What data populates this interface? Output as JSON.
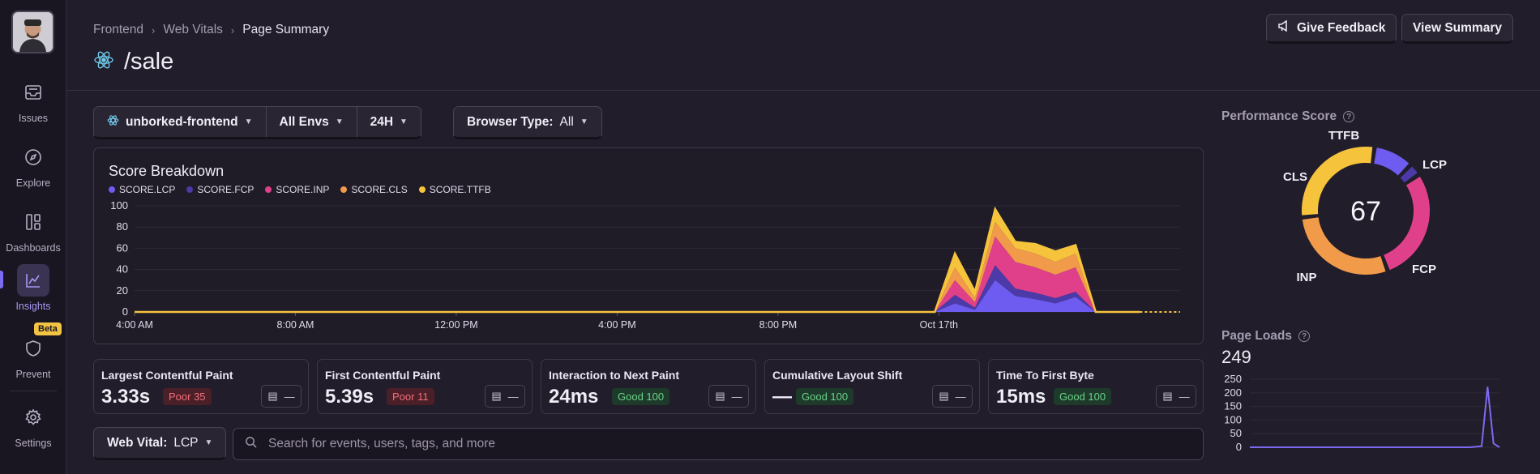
{
  "sidebar": {
    "items": [
      {
        "label": "Issues",
        "icon": "inbox-icon"
      },
      {
        "label": "Explore",
        "icon": "compass-icon"
      },
      {
        "label": "Dashboards",
        "icon": "dashboard-icon"
      },
      {
        "label": "Insights",
        "icon": "chart-icon",
        "active": true
      },
      {
        "label": "Prevent",
        "icon": "shield-icon"
      },
      {
        "label": "Settings",
        "icon": "gear-icon"
      }
    ],
    "beta_badge": "Beta"
  },
  "breadcrumb": [
    "Frontend",
    "Web Vitals",
    "Page Summary"
  ],
  "page": {
    "title": "/sale"
  },
  "header": {
    "feedback_label": "Give Feedback",
    "summary_label": "View Summary"
  },
  "filters": {
    "project": "unborked-frontend",
    "envs": "All Envs",
    "period": "24H",
    "browser_label": "Browser Type:",
    "browser_value": "All"
  },
  "colors": {
    "lcp": "#6e5cf0",
    "fcp": "#4b3aa8",
    "inp": "#e0408a",
    "cls": "#f19a4a",
    "ttfb": "#f6c33d"
  },
  "chart_data": {
    "type": "area",
    "title": "Score Breakdown",
    "legend": [
      "SCORE.LCP",
      "SCORE.FCP",
      "SCORE.INP",
      "SCORE.CLS",
      "SCORE.TTFB"
    ],
    "x_ticks": [
      "4:00 AM",
      "8:00 AM",
      "12:00 PM",
      "4:00 PM",
      "8:00 PM",
      "Oct 17th"
    ],
    "ylim": [
      0,
      100
    ],
    "y_ticks": [
      0,
      20,
      40,
      60,
      80,
      100
    ],
    "x_range_hours": [
      0,
      26
    ],
    "x": [
      0,
      19.9,
      20.4,
      20.9,
      21.4,
      21.9,
      22.4,
      22.9,
      23.4,
      23.9,
      24.4,
      25.0
    ],
    "series": [
      {
        "name": "SCORE.LCP",
        "values": [
          0,
          0,
          8,
          2,
          30,
          15,
          12,
          8,
          14,
          0,
          0,
          0
        ]
      },
      {
        "name": "SCORE.FCP",
        "values": [
          0,
          0,
          8,
          2,
          14,
          7,
          6,
          5,
          5,
          0,
          0,
          0
        ]
      },
      {
        "name": "SCORE.INP",
        "values": [
          0,
          0,
          14,
          5,
          27,
          25,
          24,
          22,
          23,
          0,
          0,
          0
        ]
      },
      {
        "name": "SCORE.CLS",
        "values": [
          0,
          0,
          12,
          4,
          14,
          13,
          13,
          12,
          13,
          0,
          0,
          0
        ]
      },
      {
        "name": "SCORE.TTFB",
        "values": [
          0,
          0,
          13,
          6,
          12,
          6,
          9,
          10,
          8,
          0,
          0,
          0
        ]
      }
    ]
  },
  "metrics": [
    {
      "name": "Largest Contentful Paint",
      "value": "3.33s",
      "badge": "Poor 35",
      "status": "poor"
    },
    {
      "name": "First Contentful Paint",
      "value": "5.39s",
      "badge": "Poor 11",
      "status": "poor"
    },
    {
      "name": "Interaction to Next Paint",
      "value": "24ms",
      "badge": "Good 100",
      "status": "good"
    },
    {
      "name": "Cumulative Layout Shift",
      "value": "—",
      "badge": "Good 100",
      "status": "good"
    },
    {
      "name": "Time To First Byte",
      "value": "15ms",
      "badge": "Good 100",
      "status": "good"
    }
  ],
  "mini_dash": "—",
  "web_vital": {
    "label": "Web Vital:",
    "value": "LCP"
  },
  "search": {
    "placeholder": "Search for events, users, tags, and more"
  },
  "performance": {
    "label": "Performance Score",
    "score": "67",
    "segments": [
      {
        "name": "LCP",
        "value": 35,
        "color": "#6e5cf0"
      },
      {
        "name": "FCP",
        "value": 11,
        "color": "#4b3aa8"
      },
      {
        "name": "INP",
        "value": 100,
        "color": "#e0408a"
      },
      {
        "name": "CLS",
        "value": 100,
        "color": "#f19a4a"
      },
      {
        "name": "TTFB",
        "value": 100,
        "color": "#f6c33d"
      }
    ]
  },
  "page_loads": {
    "label": "Page Loads",
    "total": "249",
    "y_ticks": [
      0,
      50,
      100,
      150,
      200,
      250
    ],
    "ylim": [
      0,
      250
    ],
    "values": [
      0,
      0,
      0,
      0,
      0,
      0,
      0,
      0,
      0,
      0,
      0,
      0,
      0,
      0,
      0,
      0,
      0,
      0,
      0,
      0,
      0,
      0,
      0,
      0,
      0,
      0,
      0,
      0,
      0,
      0,
      0,
      0,
      0,
      0,
      0,
      0,
      0,
      0,
      2,
      4,
      222,
      14,
      0
    ]
  }
}
